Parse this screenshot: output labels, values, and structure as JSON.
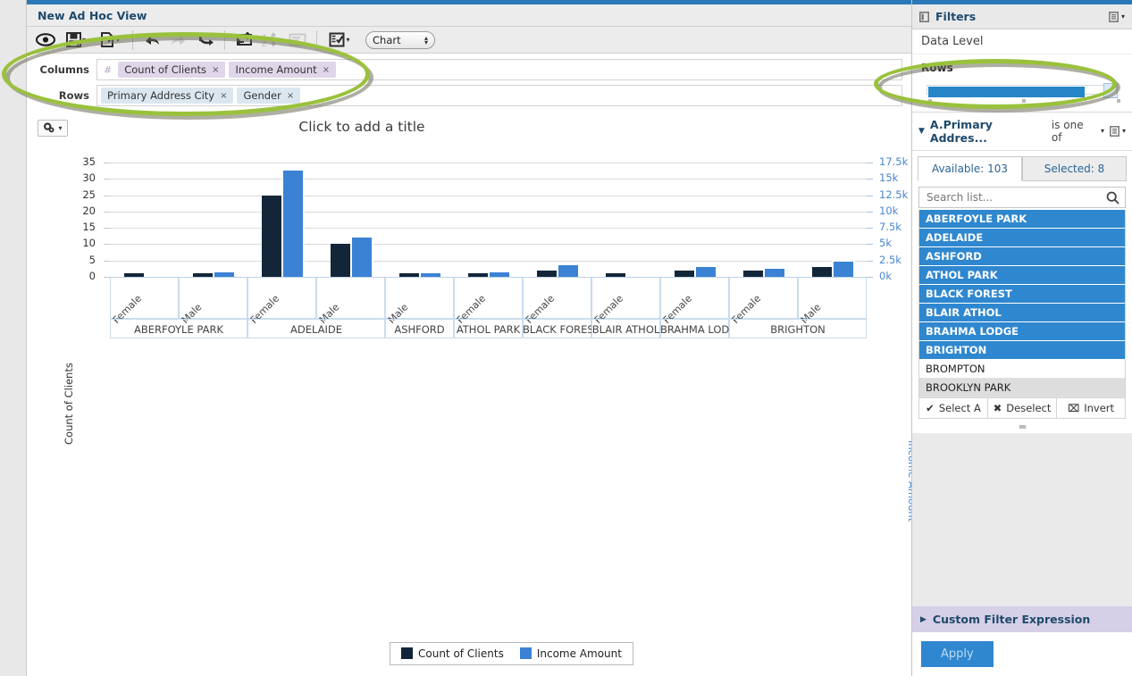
{
  "window": {
    "title": "New Ad Hoc View"
  },
  "toolbar": {
    "buttons": [
      {
        "name": "eye-icon",
        "label": "View"
      },
      {
        "name": "save-icon",
        "label": "Save"
      },
      {
        "name": "export-icon",
        "label": "Export"
      },
      {
        "name": "undo-icon",
        "label": "Undo"
      },
      {
        "name": "redo-icon",
        "label": "Redo"
      },
      {
        "name": "revert-icon",
        "label": "Undo All"
      },
      {
        "name": "switch-group-icon",
        "label": "Switch Group"
      },
      {
        "name": "sort-icon",
        "label": "Sort"
      },
      {
        "name": "page-options-icon",
        "label": "Page Options"
      },
      {
        "name": "select-display-icon",
        "label": "Display"
      }
    ],
    "view_type": "Chart"
  },
  "shelves": {
    "columns_label": "Columns",
    "rows_label": "Rows",
    "measure_marker": "#",
    "columns": [
      "Count of Clients",
      "Income Amount"
    ],
    "rows": [
      "Primary Address City",
      "Gender"
    ],
    "remove_glyph": "×"
  },
  "chart_data": {
    "type": "bar",
    "title": "Click to add a title",
    "xlabel": "",
    "ylabel": "Count of Clients",
    "y2label": "Income Amount",
    "ylim": [
      0,
      35
    ],
    "y2lim": [
      0,
      17500
    ],
    "yticks": [
      "0",
      "5",
      "10",
      "15",
      "20",
      "25",
      "30",
      "35"
    ],
    "y2ticks": [
      "0k",
      "2.5k",
      "5k",
      "7.5k",
      "10k",
      "12.5k",
      "15k",
      "17.5k"
    ],
    "grid": true,
    "legend_position": "bottom",
    "groups": [
      {
        "city": "ABERFOYLE PARK",
        "genders": [
          "Female",
          "Male"
        ]
      },
      {
        "city": "ADELAIDE",
        "genders": [
          "Female",
          "Male"
        ]
      },
      {
        "city": "ASHFORD",
        "genders": [
          "Male"
        ]
      },
      {
        "city": "ATHOL PARK",
        "genders": [
          "Female"
        ]
      },
      {
        "city": "BLACK FOREST",
        "genders": [
          "Female"
        ]
      },
      {
        "city": "BLAIR ATHOL",
        "genders": [
          "Female"
        ]
      },
      {
        "city": "BRAHMA LODGE",
        "genders": [
          "Female"
        ]
      },
      {
        "city": "BRIGHTON",
        "genders": [
          "Female",
          "Male"
        ]
      }
    ],
    "categories": [
      "ABERFOYLE PARK / Female",
      "ABERFOYLE PARK / Male",
      "ADELAIDE / Female",
      "ADELAIDE / Male",
      "ASHFORD / Male",
      "ATHOL PARK / Female",
      "BLACK FOREST / Female",
      "BLAIR ATHOL / Female",
      "BRAHMA LODGE / Female",
      "BRIGHTON / Female",
      "BRIGHTON / Male"
    ],
    "series": [
      {
        "name": "Count of Clients",
        "color": "#132639",
        "axis": "left",
        "values": [
          1,
          1,
          25,
          10,
          1,
          1,
          2,
          1,
          2,
          2,
          3
        ]
      },
      {
        "name": "Income Amount",
        "color": "#3b82d4",
        "axis": "right",
        "values": [
          0,
          650,
          16250,
          6000,
          600,
          650,
          1750,
          0,
          1500,
          1200,
          2300
        ]
      }
    ]
  },
  "filters": {
    "panel_title": "Filters",
    "data_level_label": "Data Level",
    "rows_label": "Rows",
    "filter_name": "A.Primary Addres...",
    "filter_operator": "is one of",
    "tabs": [
      {
        "label": "Available: 103",
        "active": true
      },
      {
        "label": "Selected: 8",
        "active": false
      }
    ],
    "search_placeholder": "Search list...",
    "options": [
      {
        "label": "ABERFOYLE PARK",
        "state": "selected"
      },
      {
        "label": "ADELAIDE",
        "state": "selected"
      },
      {
        "label": "ASHFORD",
        "state": "selected"
      },
      {
        "label": "ATHOL PARK",
        "state": "selected"
      },
      {
        "label": "BLACK FOREST",
        "state": "selected"
      },
      {
        "label": "BLAIR ATHOL",
        "state": "selected"
      },
      {
        "label": "BRAHMA LODGE",
        "state": "selected"
      },
      {
        "label": "BRIGHTON",
        "state": "selected"
      },
      {
        "label": "BROMPTON",
        "state": "plain"
      },
      {
        "label": "BROOKLYN PARK",
        "state": "hover"
      }
    ],
    "actions": [
      {
        "label": "Select A",
        "icon": "check-icon"
      },
      {
        "label": "Deselect",
        "icon": "cross-icon"
      },
      {
        "label": "Invert",
        "icon": "invert-icon"
      }
    ],
    "custom_filter_expression": "Custom Filter Expression",
    "apply_label": "Apply"
  },
  "colors": {
    "accent_blue": "#2f87cf",
    "series_dark": "#132639",
    "series_blue": "#3b82d4",
    "annotation_green": "#9ac13c",
    "title_navy": "#1f4a6b"
  }
}
